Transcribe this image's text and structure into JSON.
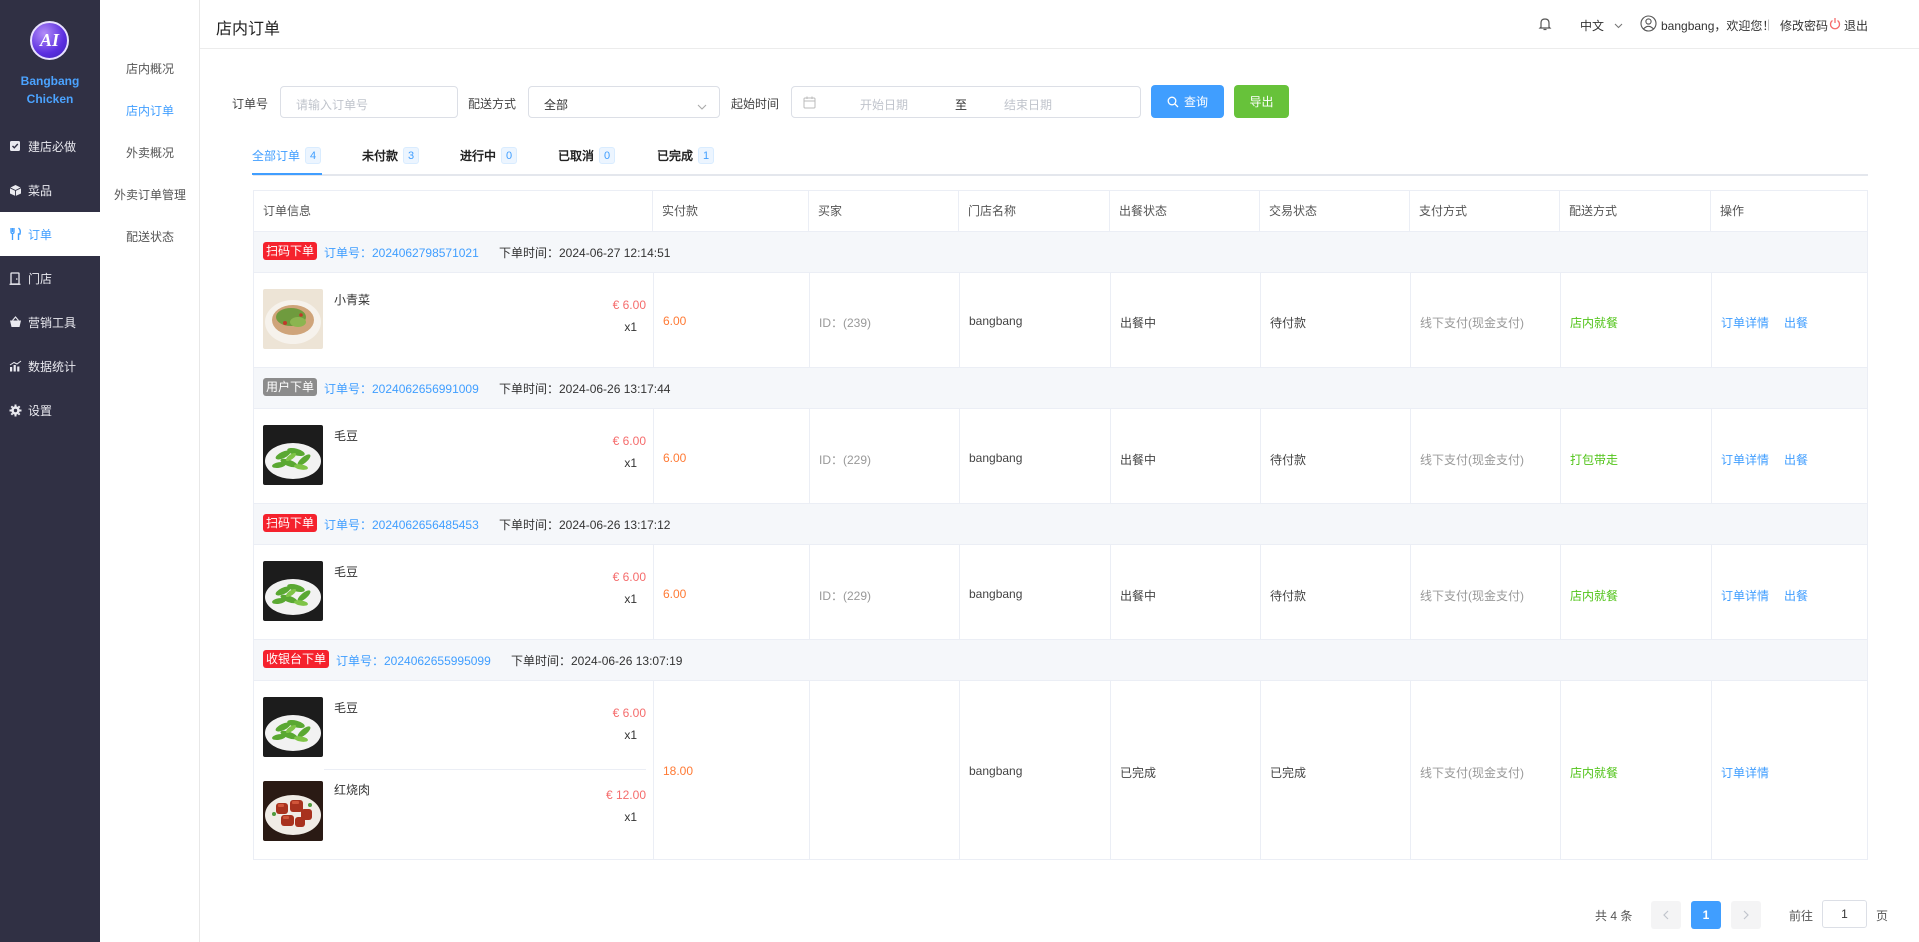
{
  "brand": {
    "name_line1": "Bangbang",
    "name_line2": "Chicken",
    "logo_letters": "AI"
  },
  "sidebar": {
    "items": [
      {
        "label": "建店必做",
        "icon": "checklist-icon"
      },
      {
        "label": "菜品",
        "icon": "box-icon"
      },
      {
        "label": "订单",
        "icon": "cutlery-icon",
        "active": true
      },
      {
        "label": "门店",
        "icon": "door-icon"
      },
      {
        "label": "营销工具",
        "icon": "basket-icon"
      },
      {
        "label": "数据统计",
        "icon": "chart-icon"
      },
      {
        "label": "设置",
        "icon": "gear-icon"
      }
    ]
  },
  "subnav": {
    "items": [
      {
        "label": "店内概况"
      },
      {
        "label": "店内订单",
        "active": true
      },
      {
        "label": "外卖概况"
      },
      {
        "label": "外卖订单管理"
      },
      {
        "label": "配送状态"
      }
    ]
  },
  "header": {
    "title": "店内订单",
    "language": "中文",
    "user_greeting": "bangbang，欢迎您！",
    "separator": "|",
    "change_password": "修改密码",
    "logout": "退出"
  },
  "filters": {
    "order_no_label": "订单号",
    "order_no_placeholder": "请输入订单号",
    "delivery_label": "配送方式",
    "delivery_value": "全部",
    "start_time_label": "起始时间",
    "start_placeholder": "开始日期",
    "range_sep": "至",
    "end_placeholder": "结束日期",
    "search_button": "查询",
    "export_button": "导出"
  },
  "tabs": [
    {
      "label": "全部订单",
      "count": "4",
      "active": true
    },
    {
      "label": "未付款",
      "count": "3"
    },
    {
      "label": "进行中",
      "count": "0"
    },
    {
      "label": "已取消",
      "count": "0"
    },
    {
      "label": "已完成",
      "count": "1"
    }
  ],
  "table": {
    "headers": [
      "订单信息",
      "实付款",
      "买家",
      "门店名称",
      "出餐状态",
      "交易状态",
      "支付方式",
      "配送方式",
      "操作"
    ],
    "orders": [
      {
        "tag": "扫码下单",
        "tag_color": "#f5222d",
        "order_no": "订单号：2024062798571021",
        "time": "下单时间：2024-06-27 12:14:51",
        "items": [
          {
            "name": "小青菜",
            "price": "€ 6.00",
            "qty": "x1",
            "image": "salad-dish"
          }
        ],
        "paid": "6.00",
        "buyer": "ID：(239)",
        "store": "bangbang",
        "meal_status": "出餐中",
        "trade_status": "待付款",
        "pay_method": "线下支付(现金支付)",
        "delivery": "店内就餐",
        "actions": [
          "订单详情",
          "出餐"
        ]
      },
      {
        "tag": "用户下单",
        "tag_color": "#8c8c8c",
        "order_no": "订单号：2024062656991009",
        "time": "下单时间：2024-06-26 13:17:44",
        "items": [
          {
            "name": "毛豆",
            "price": "€ 6.00",
            "qty": "x1",
            "image": "edamame-dish"
          }
        ],
        "paid": "6.00",
        "buyer": "ID：(229)",
        "store": "bangbang",
        "meal_status": "出餐中",
        "trade_status": "待付款",
        "pay_method": "线下支付(现金支付)",
        "delivery": "打包带走",
        "actions": [
          "订单详情",
          "出餐"
        ]
      },
      {
        "tag": "扫码下单",
        "tag_color": "#f5222d",
        "order_no": "订单号：2024062656485453",
        "time": "下单时间：2024-06-26 13:17:12",
        "items": [
          {
            "name": "毛豆",
            "price": "€ 6.00",
            "qty": "x1",
            "image": "edamame-dish"
          }
        ],
        "paid": "6.00",
        "buyer": "ID：(229)",
        "store": "bangbang",
        "meal_status": "出餐中",
        "trade_status": "待付款",
        "pay_method": "线下支付(现金支付)",
        "delivery": "店内就餐",
        "actions": [
          "订单详情",
          "出餐"
        ]
      },
      {
        "tag": "收银台下单",
        "tag_color": "#f5222d",
        "order_no": "订单号：2024062655995099",
        "time": "下单时间：2024-06-26 13:07:19",
        "items": [
          {
            "name": "毛豆",
            "price": "€ 6.00",
            "qty": "x1",
            "image": "edamame-dish"
          },
          {
            "name": "红烧肉",
            "price": "€ 12.00",
            "qty": "x1",
            "image": "braised-pork-dish"
          }
        ],
        "paid": "18.00",
        "buyer": "",
        "store": "bangbang",
        "meal_status": "已完成",
        "trade_status": "已完成",
        "pay_method": "线下支付(现金支付)",
        "delivery": "店内就餐",
        "actions": [
          "订单详情"
        ]
      }
    ]
  },
  "pagination": {
    "total": "共 4 条",
    "current": "1",
    "goto_label": "前往",
    "goto_value": "1",
    "page_suffix": "页"
  },
  "colors": {
    "primary": "#409eff",
    "success": "#67c23a",
    "sidebar": "#303044",
    "danger": "#f5222d",
    "paid": "#ff7a35"
  }
}
